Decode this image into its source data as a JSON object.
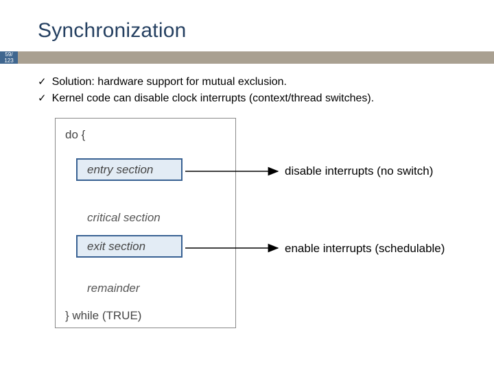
{
  "page_badge": "59/\n123",
  "title": "Synchronization",
  "bullets": [
    "Solution: hardware support for mutual exclusion.",
    "Kernel code can disable clock interrupts (context/thread switches)."
  ],
  "diagram": {
    "do_line": "do {",
    "entry_label": "entry section",
    "critical_label": "critical section",
    "exit_label": "exit section",
    "remainder_label": "remainder",
    "while_line": "} while (TRUE)"
  },
  "annotations": [
    "disable interrupts (no switch)",
    "enable interrupts (schedulable)"
  ]
}
